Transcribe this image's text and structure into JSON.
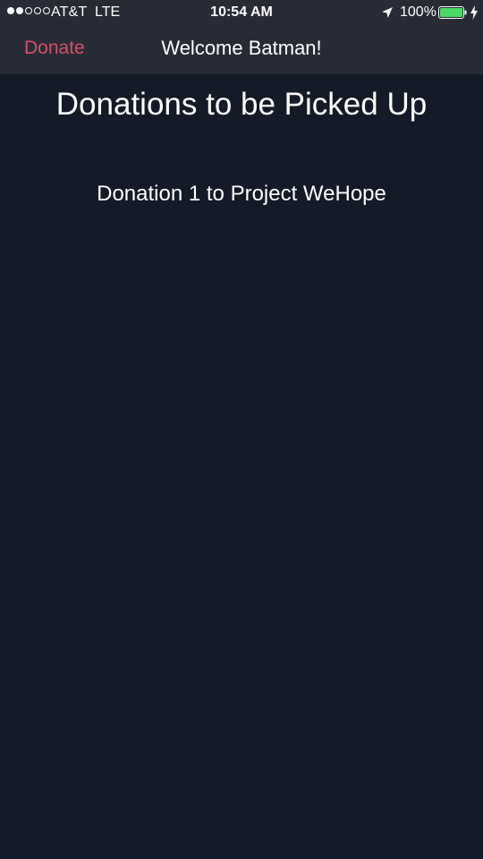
{
  "status_bar": {
    "signal_filled": 2,
    "signal_empty": 3,
    "carrier": "AT&T",
    "network": "LTE",
    "time": "10:54 AM",
    "battery_percent": "100%",
    "location_icon": "location-arrow-icon",
    "battery_icon": "battery-full-icon",
    "charging_icon": "charging-bolt-icon",
    "battery_color": "#4cd964"
  },
  "nav": {
    "left_button": "Donate",
    "title": "Welcome Batman!",
    "accent_color": "#d9516a"
  },
  "main": {
    "title": "Donations to be Picked Up",
    "donations": [
      {
        "label": "Donation 1 to Project WeHope"
      }
    ]
  }
}
